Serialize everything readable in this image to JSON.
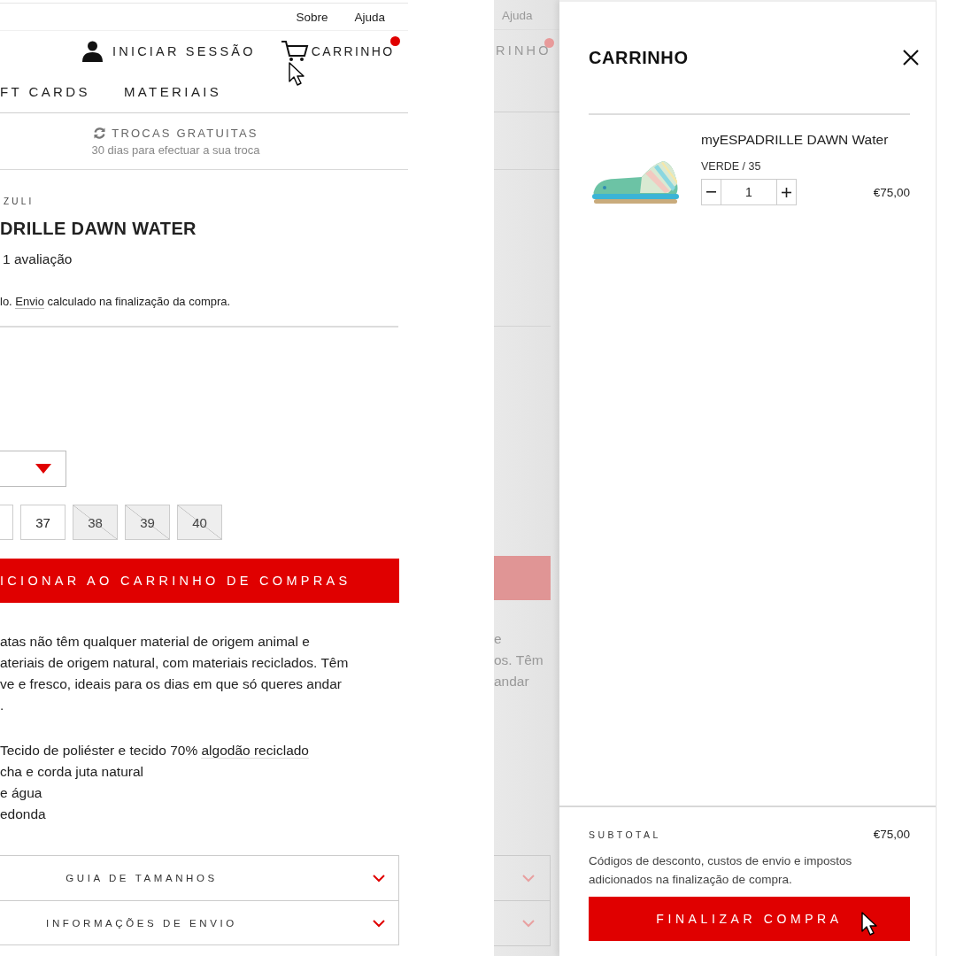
{
  "product_page": {
    "utility_links": [
      "Sobre",
      "Ajuda"
    ],
    "account_link": "INICIAR SESSÃO",
    "cart_link": {
      "label": "CARRINHO",
      "has_items": true
    },
    "nav_items": [
      "FT CARDS",
      "MATERIAIS"
    ],
    "promo": {
      "title": "TROCAS GRATUITAS",
      "subtitle": "30 dias para efectuar a sua troca"
    },
    "brand": "ZULI",
    "title": "DRILLE DAWN WATER",
    "reviews": "1 avaliação",
    "shipping_note": {
      "before": "lo. ",
      "link": "Envio",
      "after": " calculado na finalização da compra."
    },
    "sizes": [
      {
        "available": true
      },
      {
        "label": "37",
        "available": true
      },
      {
        "label": "38",
        "available": false
      },
      {
        "label": "39",
        "available": false
      },
      {
        "label": "40",
        "available": false
      }
    ],
    "add_button": "ICIONAR AO CARRINHO DE COMPRAS",
    "description_lines": [
      "atas não têm qualquer material de origem animal e",
      "ateriais de origem natural, com materiais reciclados. Têm",
      "ve e fresco, ideais para os dias em que só queres andar",
      "."
    ],
    "features": [
      {
        "text": "Tecido de poliéster e tecido 70% ",
        "link": "algodão reciclado"
      },
      {
        "text": "cha e corda juta natural"
      },
      {
        "text": "e água"
      },
      {
        "text": "edonda"
      }
    ],
    "accordions": [
      {
        "label": "GUIA DE TAMANHOS",
        "expanded": false
      },
      {
        "label": "INFORMAÇÕES DE ENVIO",
        "expanded": false
      }
    ]
  },
  "dimmed_page": {
    "utility_link": "Ajuda",
    "cart_link": {
      "label": "RINHO",
      "has_items": true
    },
    "description_fragments": [
      "e",
      "os. Têm",
      "andar"
    ],
    "accordions": [
      {
        "expanded": false
      },
      {
        "expanded": false
      }
    ]
  },
  "cart": {
    "title": "CARRINHO",
    "items": [
      {
        "kind": "picture",
        "name": "myESPADRILLE DAWN Water",
        "variant": "VERDE / 35",
        "quantity": "1",
        "price": "€75,00"
      }
    ],
    "subtotal_label": "SUBTOTAL",
    "subtotal": "€75,00",
    "note": "Códigos de desconto, custos de envio e impostos adicionados na finalização de compra.",
    "checkout_button": "FINALIZAR COMPRA"
  }
}
